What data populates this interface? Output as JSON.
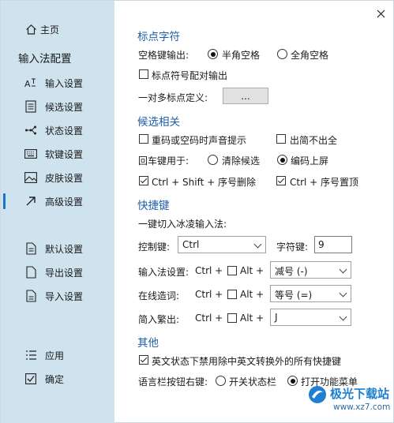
{
  "window": {
    "close_label": "✕"
  },
  "sidebar": {
    "home": "主页",
    "heading": "输入法配置",
    "items": [
      {
        "label": "输入设置",
        "icon": "input-settings-icon"
      },
      {
        "label": "候选设置",
        "icon": "candidate-settings-icon"
      },
      {
        "label": "状态设置",
        "icon": "status-settings-icon"
      },
      {
        "label": "软键设置",
        "icon": "keyboard-icon"
      },
      {
        "label": "皮肤设置",
        "icon": "skin-image-icon"
      },
      {
        "label": "高级设置",
        "icon": "advanced-arrow-icon"
      }
    ],
    "actions": [
      {
        "label": "默认设置",
        "icon": "default-doc-icon"
      },
      {
        "label": "导出设置",
        "icon": "export-doc-icon"
      },
      {
        "label": "导入设置",
        "icon": "import-doc-icon"
      }
    ],
    "apply": "应用",
    "ok": "确定",
    "active_index": 5
  },
  "punct": {
    "title": "标点字符",
    "space_label": "空格键输出:",
    "half_label": "半角空格",
    "full_label": "全角空格",
    "half_selected": true,
    "pair_label": "标点符号配对输出",
    "pair_checked": false,
    "multi_label": "一对多标点定义:",
    "multi_button": "..."
  },
  "cand": {
    "title": "候选相关",
    "dup_sound": "重码或空码时声音提示",
    "dup_sound_checked": false,
    "simple_label": "出简不出全",
    "simple_checked": false,
    "enter_label": "回车键用于:",
    "enter_clear": "清除候选",
    "enter_code": "编码上屏",
    "enter_code_selected": true,
    "ctrl_shift_label": "Ctrl + Shift + 序号删除",
    "ctrl_shift_checked": true,
    "ctrl_top_label": "Ctrl + 序号置顶",
    "ctrl_top_checked": true
  },
  "shortcut": {
    "title": "快捷键",
    "toggle_label": "一键切入冰凌输入法:",
    "ctrl_key_label": "控制键:",
    "ctrl_key_value": "Ctrl",
    "char_key_label": "字符键:",
    "char_key_value": "9",
    "ctrl_plus": "Ctrl +",
    "alt_plus": "Alt +",
    "rows": [
      {
        "label": "输入法设置:",
        "alt_checked": false,
        "value": "减号 (-)"
      },
      {
        "label": "在线造词:",
        "alt_checked": false,
        "value": "等号 (=)"
      },
      {
        "label": "简入繁出:",
        "alt_checked": false,
        "value": "J"
      }
    ]
  },
  "other": {
    "title": "其他",
    "disable_label": "英文状态下禁用除中英文转换外的所有快捷键",
    "disable_checked": true,
    "langbar_label": "语言栏按钮右键:",
    "langbar_status": "开关状态栏",
    "langbar_menu": "打开功能菜单",
    "langbar_menu_selected": true
  },
  "watermark": {
    "text": "极光下载站",
    "url": "www.xz7.com",
    "brand_color": "#1f7fd1"
  },
  "colors": {
    "sidebar_bg": "#cfe3ef",
    "section_title": "#1d5fa8",
    "active_bar": "#1a73c8"
  }
}
